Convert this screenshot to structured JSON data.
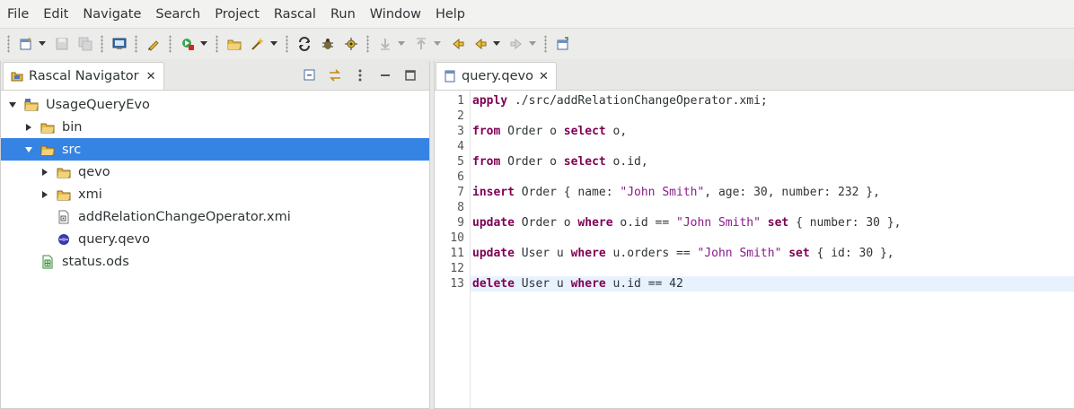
{
  "menubar": {
    "items": [
      "File",
      "Edit",
      "Navigate",
      "Search",
      "Project",
      "Rascal",
      "Run",
      "Window",
      "Help"
    ]
  },
  "toolbar": {
    "buttons": [
      "new-icon",
      "save-icon",
      "save-all-icon",
      "terminal-icon",
      "edit-icon",
      "debug-run-icon",
      "open-folder-icon",
      "wand-icon",
      "refresh-icon",
      "bug-icon",
      "gear-bug-icon",
      "next-annotation-icon",
      "prev-annotation-icon",
      "back-icon",
      "forward-icon",
      "open-perspective-icon"
    ]
  },
  "navigator": {
    "tab_label": "Rascal Navigator",
    "tree": [
      {
        "label": "UsageQueryEvo",
        "depth": 0,
        "expanded": true,
        "icon": "project-folder-icon"
      },
      {
        "label": "bin",
        "depth": 1,
        "expanded": false,
        "icon": "folder-icon"
      },
      {
        "label": "src",
        "depth": 1,
        "expanded": true,
        "icon": "folder-open-icon",
        "selected": true
      },
      {
        "label": "qevo",
        "depth": 2,
        "expanded": false,
        "icon": "folder-icon"
      },
      {
        "label": "xmi",
        "depth": 2,
        "expanded": false,
        "icon": "folder-icon"
      },
      {
        "label": "addRelationChangeOperator.xmi",
        "depth": 2,
        "icon": "xmi-file-icon"
      },
      {
        "label": "query.qevo",
        "depth": 2,
        "icon": "qevo-file-icon"
      },
      {
        "label": "status.ods",
        "depth": 1,
        "icon": "spreadsheet-icon"
      }
    ]
  },
  "editor": {
    "tab_label": "query.qevo",
    "line_numbers": [
      "1",
      "2",
      "3",
      "4",
      "5",
      "6",
      "7",
      "8",
      "9",
      "10",
      "11",
      "12",
      "13"
    ],
    "current_line": 13,
    "lines": [
      [
        {
          "t": "kw",
          "v": "apply"
        },
        {
          "t": "",
          "v": " ./src/addRelationChangeOperator.xmi;"
        }
      ],
      [],
      [
        {
          "t": "kw",
          "v": "from"
        },
        {
          "t": "",
          "v": " Order o "
        },
        {
          "t": "kw",
          "v": "select"
        },
        {
          "t": "",
          "v": " o,"
        }
      ],
      [],
      [
        {
          "t": "kw",
          "v": "from"
        },
        {
          "t": "",
          "v": " Order o "
        },
        {
          "t": "kw",
          "v": "select"
        },
        {
          "t": "",
          "v": " o.id,"
        }
      ],
      [],
      [
        {
          "t": "kw",
          "v": "insert"
        },
        {
          "t": "",
          "v": " Order { name: "
        },
        {
          "t": "str2",
          "v": "\"John Smith\""
        },
        {
          "t": "",
          "v": ", age: 30, number: 232 },"
        }
      ],
      [],
      [
        {
          "t": "kw",
          "v": "update"
        },
        {
          "t": "",
          "v": " Order o "
        },
        {
          "t": "kw",
          "v": "where"
        },
        {
          "t": "",
          "v": " o.id == "
        },
        {
          "t": "str2",
          "v": "\"John Smith\""
        },
        {
          "t": "",
          "v": " "
        },
        {
          "t": "kw",
          "v": "set"
        },
        {
          "t": "",
          "v": " { number: 30 },"
        }
      ],
      [],
      [
        {
          "t": "kw",
          "v": "update"
        },
        {
          "t": "",
          "v": " User u "
        },
        {
          "t": "kw",
          "v": "where"
        },
        {
          "t": "",
          "v": " u.orders == "
        },
        {
          "t": "str2",
          "v": "\"John Smith\""
        },
        {
          "t": "",
          "v": " "
        },
        {
          "t": "kw",
          "v": "set"
        },
        {
          "t": "",
          "v": " { id: 30 },"
        }
      ],
      [],
      [
        {
          "t": "kw",
          "v": "delete"
        },
        {
          "t": "",
          "v": " User u "
        },
        {
          "t": "kw",
          "v": "where"
        },
        {
          "t": "",
          "v": " u.id == 42"
        }
      ]
    ]
  },
  "colors": {
    "selection": "#3584e4",
    "keyword": "#7f0055",
    "string": "#8b1a8b",
    "current_line": "#e8f2fe"
  }
}
